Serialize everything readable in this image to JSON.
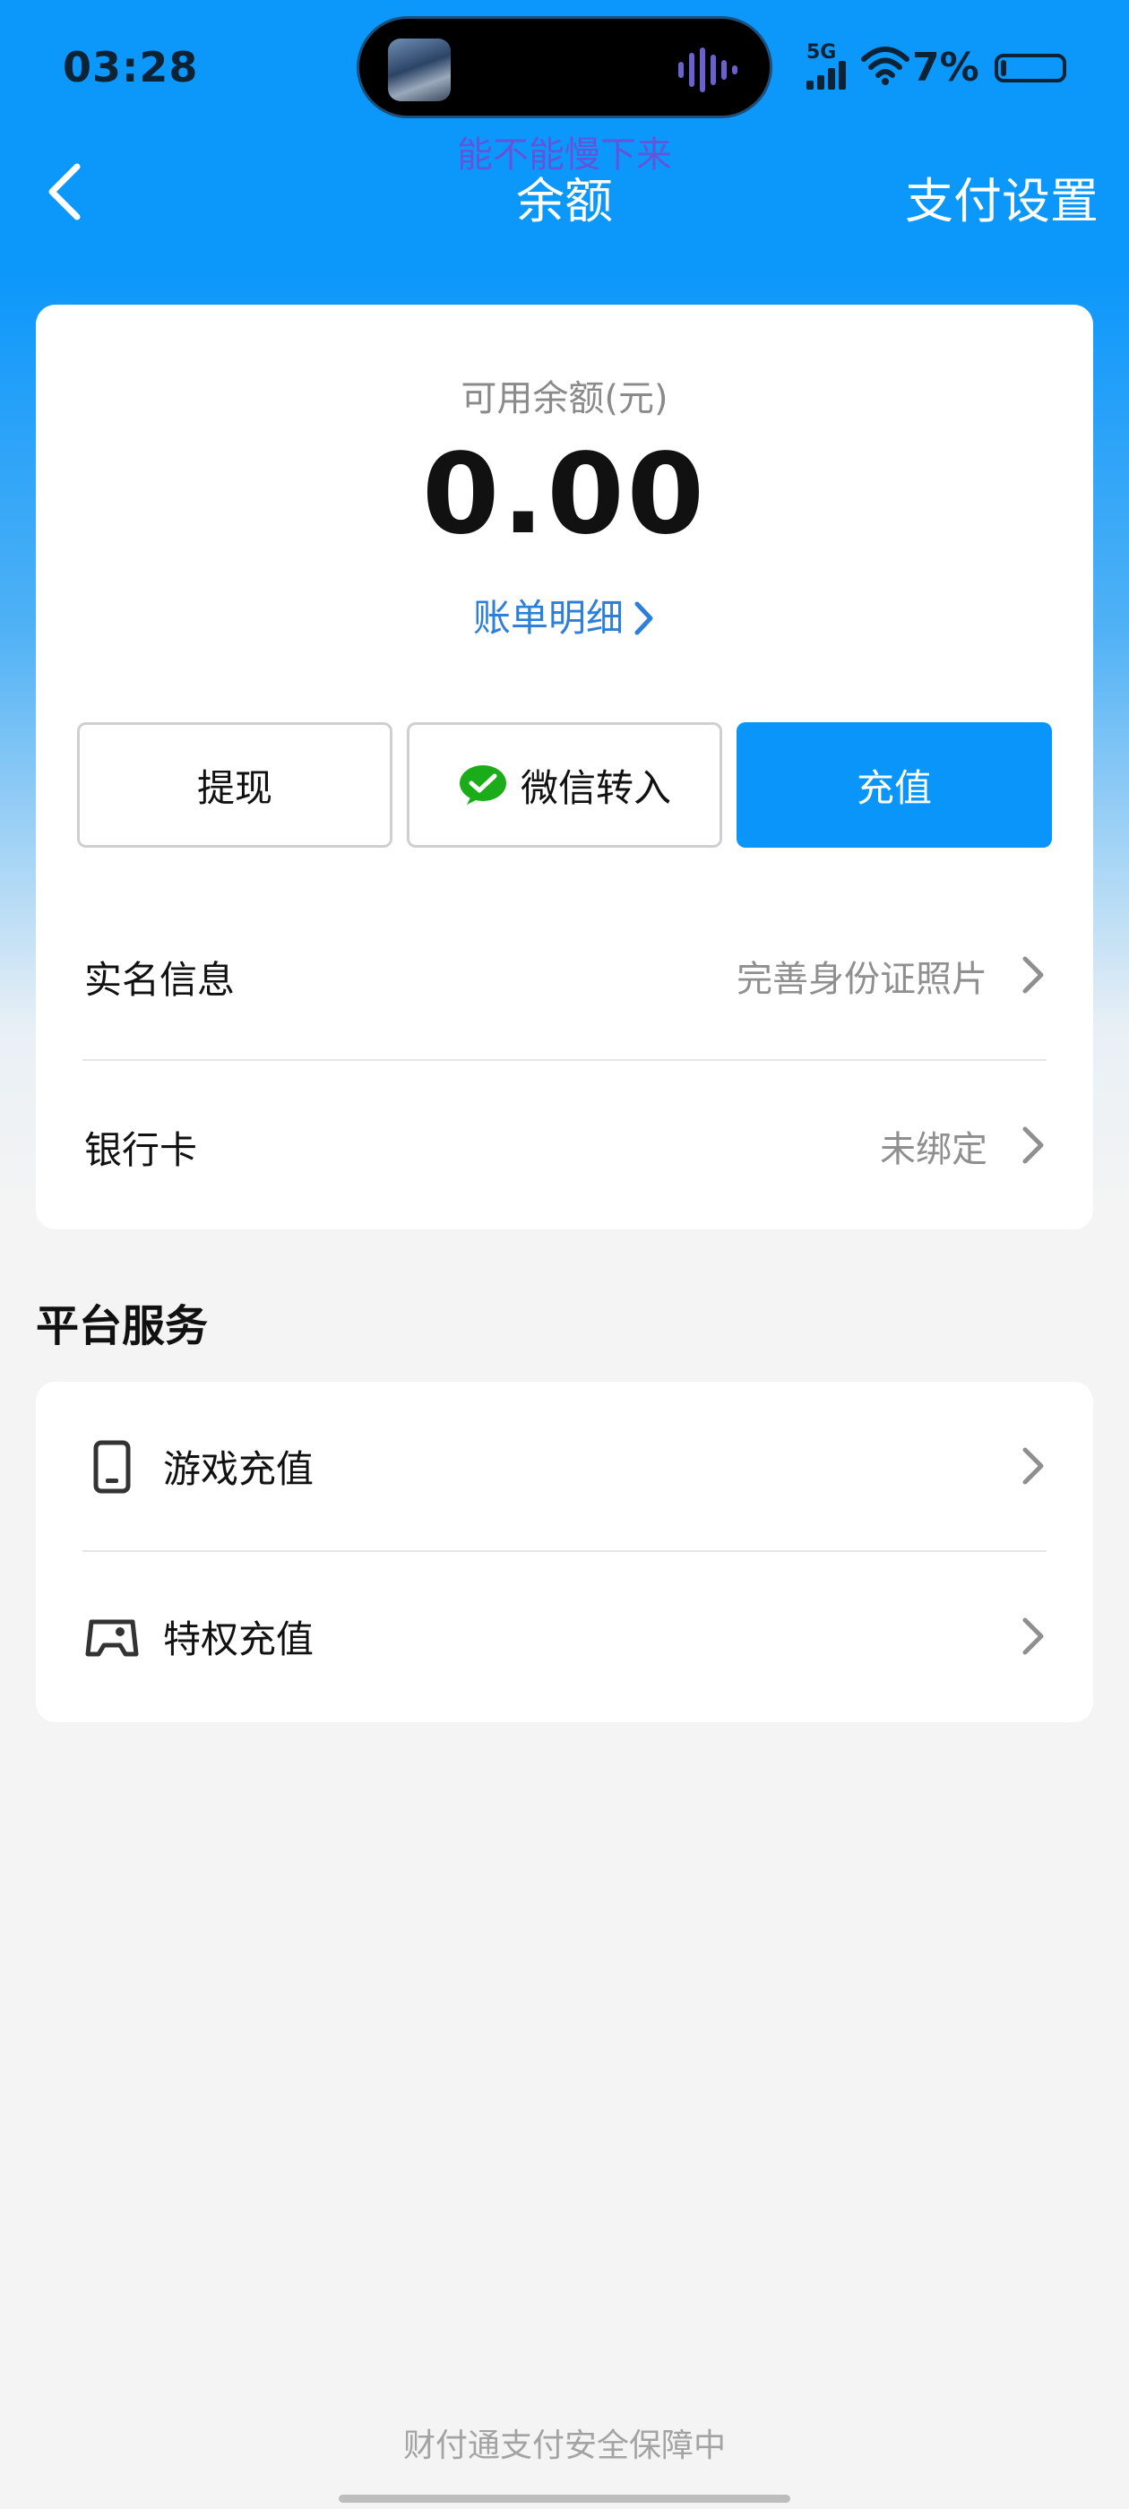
{
  "status_bar": {
    "time": "03:28",
    "network": "5G",
    "battery_percent": "7%",
    "lyric": "能不能慢下来"
  },
  "nav": {
    "title": "余额",
    "right_action": "支付设置"
  },
  "balance": {
    "label": "可用余额(元)",
    "value": "0.00",
    "bill_link": "账单明细"
  },
  "actions": {
    "withdraw": "提现",
    "wechat_transfer": "微信转入",
    "recharge": "充值"
  },
  "account_rows": [
    {
      "label": "实名信息",
      "value": "完善身份证照片"
    },
    {
      "label": "银行卡",
      "value": "未绑定"
    }
  ],
  "services": {
    "title": "平台服务",
    "items": [
      {
        "label": "游戏充值",
        "icon": "phone-icon"
      },
      {
        "label": "特权充值",
        "icon": "gamepad-icon"
      }
    ]
  },
  "footer": {
    "note": "财付通支付安全保障中"
  },
  "colors": {
    "accent": "#0a95fb",
    "link": "#2e7fd9"
  }
}
